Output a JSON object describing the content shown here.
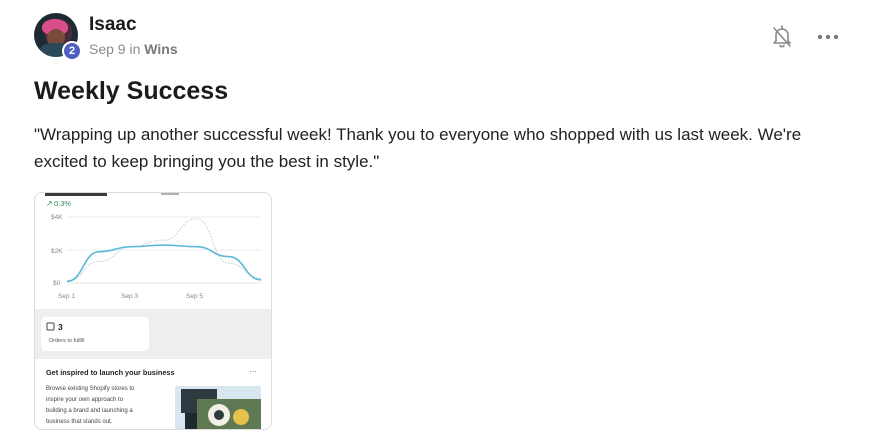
{
  "post": {
    "author": "Isaac",
    "level": "2",
    "date": "Sep 9",
    "in_word": "in",
    "category": "Wins",
    "title": "Weekly Success",
    "body": "\"Wrapping up another successful week! Thank you to everyone who shopped with us last week. We're excited to keep bringing you the best in style.\""
  },
  "icons": {
    "notifications": "bell-off-icon",
    "more": "more-horizontal-icon"
  },
  "attachment": {
    "chart": {
      "change": "0.3%",
      "y_ticks": [
        "$4K",
        "$2K",
        "$0"
      ],
      "x_ticks": [
        "Sep 1",
        "Sep 3",
        "Sep 5"
      ]
    },
    "orders_count": "3",
    "orders_label": "Orders to fulfill",
    "promo_title": "Get inspired to launch your business",
    "promo_more": "···",
    "promo_lines": [
      "Browse existing Shopify stores to",
      "inspire your own approach to",
      "building a brand and launching a",
      "business that stands out."
    ]
  },
  "chart_data": {
    "type": "line",
    "x": [
      "Sep 1",
      "",
      "Sep 3",
      "",
      "Sep 5",
      "",
      ""
    ],
    "ylim": [
      0,
      4000
    ],
    "series": [
      {
        "values": [
          100,
          1900,
          2200,
          2300,
          2200,
          1600,
          200
        ]
      },
      {
        "values": [
          100,
          1300,
          2200,
          2600,
          3900,
          1200,
          300
        ]
      }
    ]
  }
}
